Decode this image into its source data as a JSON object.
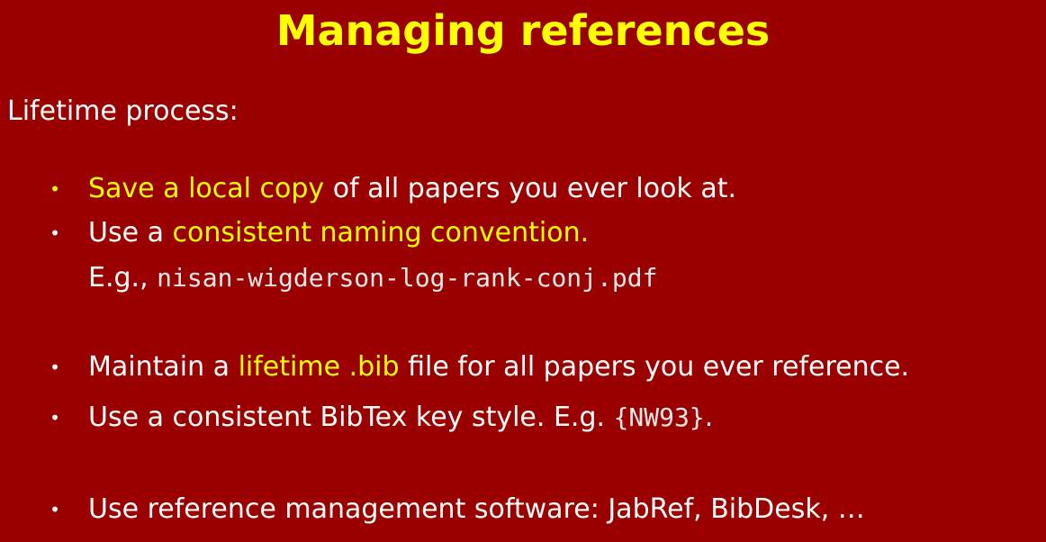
{
  "slide": {
    "title": "Managing references",
    "intro": "Lifetime process:",
    "bullets": [
      {
        "highlight": "Save a local copy",
        "rest": " of all papers you ever look at."
      },
      {
        "prefix": "Use a ",
        "highlight": "consistent naming convention.",
        "example_label": "E.g., ",
        "example_code": "nisan-wigderson-log-rank-conj.pdf"
      },
      {
        "prefix": "Maintain a ",
        "highlight": "lifetime .bib",
        "rest": " file for all papers you ever reference."
      },
      {
        "prefix": "Use a consistent BibTex key style.  E.g. ",
        "code": "{NW93}",
        "suffix": "."
      },
      {
        "text": "Use reference management software:  JabRef, BibDesk, …"
      }
    ],
    "bullet_glyph": "•"
  },
  "colors": {
    "background": "#9b0000",
    "highlight": "#ffff00",
    "text": "#ffffff"
  }
}
